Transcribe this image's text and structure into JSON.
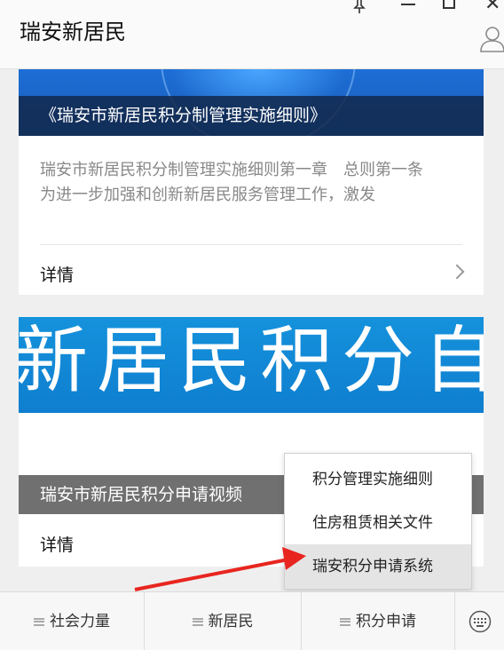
{
  "header": {
    "title": "瑞安新居民",
    "pin_glyph": "⊥",
    "close_glyph": "✕"
  },
  "cards": [
    {
      "caption": "《瑞安市新居民积分制管理实施细则》",
      "description": "瑞安市新居民积分制管理实施细则第一章　总则第一条　为进一步加强和创新新居民服务管理工作，激发",
      "detail_label": "详情"
    },
    {
      "banner_text": "新居民积分自",
      "caption": "瑞安市新居民积分申请视频",
      "detail_label": "详情"
    }
  ],
  "popup_menu": {
    "items": [
      {
        "label": "积分管理实施细则"
      },
      {
        "label": "住房租赁相关文件"
      },
      {
        "label": "瑞安积分申请系统",
        "highlighted": true
      }
    ]
  },
  "bottom_nav": {
    "items": [
      {
        "label": "社会力量"
      },
      {
        "label": "新居民"
      },
      {
        "label": "积分申请"
      }
    ]
  },
  "icons": {
    "pin": "pin-icon",
    "minimize": "minimize-icon",
    "maximize": "maximize-icon",
    "close": "close-icon",
    "user": "user-icon",
    "chevron": "chevron-right-icon",
    "menu": "hamburger-icon",
    "keyboard": "keyboard-icon"
  },
  "colors": {
    "annotation_arrow": "#e8251f",
    "banner1": "#1d6ed6",
    "banner2": "#1592dc",
    "caption2_bg": "#707070"
  }
}
